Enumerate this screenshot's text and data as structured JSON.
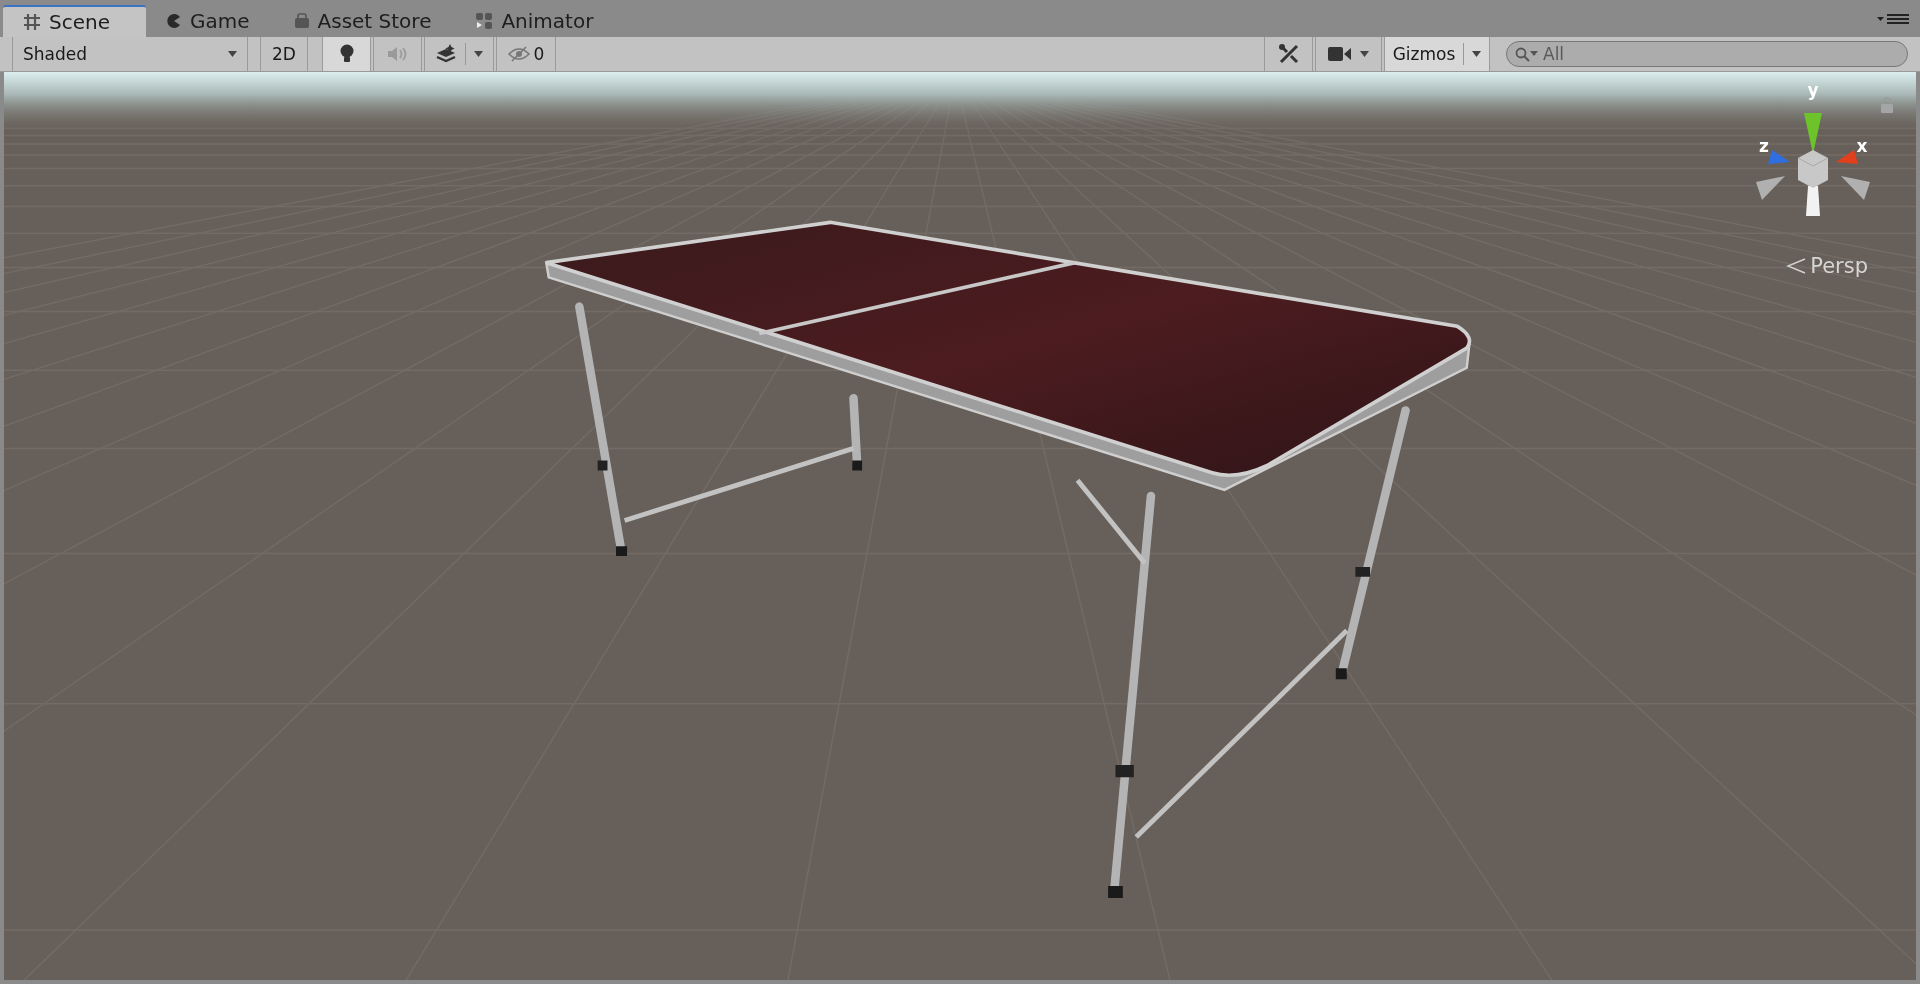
{
  "tabs": [
    {
      "kind": "scene",
      "label": "Scene",
      "selected": true
    },
    {
      "kind": "game",
      "label": "Game",
      "selected": false
    },
    {
      "kind": "asset-store",
      "label": "Asset Store",
      "selected": false
    },
    {
      "kind": "animator",
      "label": "Animator",
      "selected": false
    }
  ],
  "toolbar": {
    "draw_mode": "Shaded",
    "mode_2d": {
      "label": "2D",
      "on": false
    },
    "toggles": [
      {
        "kind": "lighting",
        "on": true,
        "pressed": true
      },
      {
        "kind": "audio",
        "on": false,
        "pressed": false
      },
      {
        "kind": "effects",
        "on": true,
        "pressed": false
      }
    ],
    "hidden_count": "0",
    "gizmos": {
      "label": "Gizmos",
      "on": true
    },
    "search": {
      "placeholder": "All"
    }
  },
  "viewport": {
    "axes": [
      {
        "kind": "y",
        "label": "y"
      },
      {
        "kind": "z",
        "label": "z"
      },
      {
        "kind": "x",
        "label": "x"
      }
    ],
    "projection": "Persp"
  }
}
